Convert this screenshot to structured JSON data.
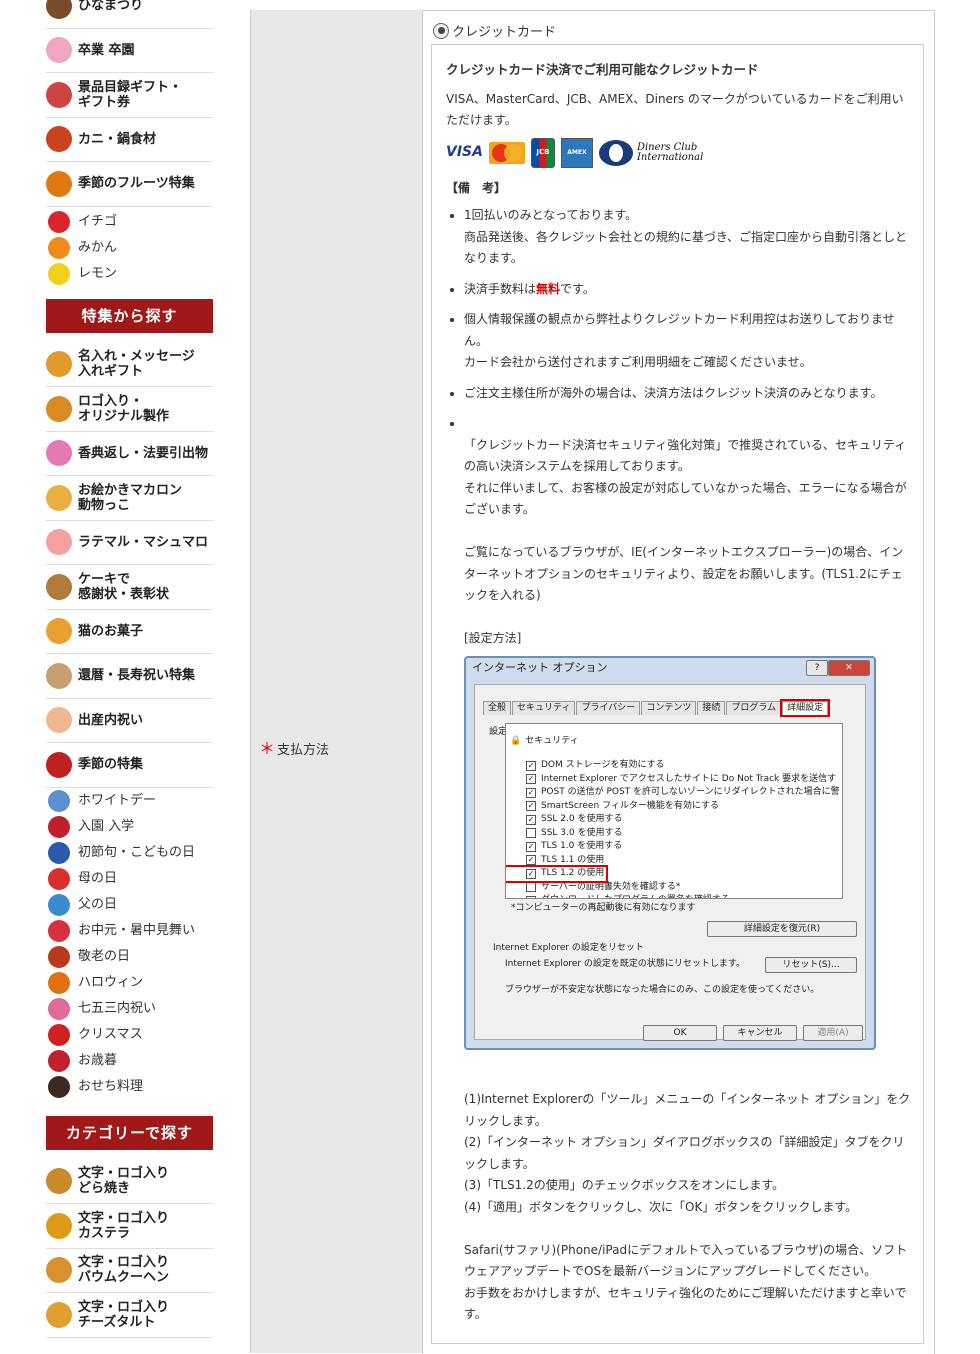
{
  "sidebar": {
    "top_items": [
      {
        "label": "ひなまつり",
        "color": "#7a4a2a",
        "icon": "hinamatsuri-icon"
      },
      {
        "label": "卒業 卒園",
        "color": "#f0a5c0",
        "icon": "sakura-icon"
      },
      {
        "label": "景品目録ギフト・\nギフト券",
        "color": "#c44",
        "icon": "gift-list-icon"
      },
      {
        "label": "カニ・鍋食材",
        "color": "#c8431e",
        "icon": "crab-icon"
      },
      {
        "label": "季節のフルーツ特集",
        "color": "#e07a10",
        "icon": "fruit-icon"
      }
    ],
    "fruit_items": [
      {
        "label": "イチゴ",
        "color": "#d8262b",
        "icon": "strawberry-icon"
      },
      {
        "label": "みかん",
        "color": "#f08a1a",
        "icon": "mandarin-icon"
      },
      {
        "label": "レモン",
        "color": "#f0d01a",
        "icon": "lemon-icon"
      }
    ],
    "feature_header": "特集から探す",
    "feature_items": [
      {
        "label": "名入れ・メッセージ\n入れギフト",
        "color": "#e09a2a",
        "icon": "name-gift-icon"
      },
      {
        "label": "ロゴ入り・\nオリジナル製作",
        "color": "#d98a22",
        "icon": "logo-original-icon"
      },
      {
        "label": "香典返し・法要引出物",
        "color": "#e57ab0",
        "icon": "lotus-icon"
      },
      {
        "label": "お絵かきマカロン\n動物っこ",
        "color": "#e8b040",
        "icon": "macaron-icon"
      },
      {
        "label": "ラテマル・マシュマロ",
        "color": "#f4a0a0",
        "icon": "marshmallow-icon"
      },
      {
        "label": "ケーキで\n感謝状・表彰状",
        "color": "#b07a3a",
        "icon": "cake-certificate-icon"
      },
      {
        "label": "猫のお菓子",
        "color": "#e8a030",
        "icon": "cat-sweets-icon"
      },
      {
        "label": "還暦・長寿祝い特集",
        "color": "#c8a070",
        "icon": "elder-icon"
      },
      {
        "label": "出産内祝い",
        "color": "#f0b890",
        "icon": "baby-icon"
      },
      {
        "label": "季節の特集",
        "color": "#c02020",
        "icon": "season-kanji-icon"
      }
    ],
    "season_items": [
      {
        "label": "ホワイトデー",
        "color": "#5a8fd0",
        "icon": "whiteday-icon"
      },
      {
        "label": "入園 入学",
        "color": "#c0202a",
        "icon": "school-bag-icon"
      },
      {
        "label": "初節句・こどもの日",
        "color": "#2a5ab0",
        "icon": "koinobori-icon"
      },
      {
        "label": "母の日",
        "color": "#d83030",
        "icon": "carnation-icon"
      },
      {
        "label": "父の日",
        "color": "#3a8ad0",
        "icon": "father-icon"
      },
      {
        "label": "お中元・暑中見舞い",
        "color": "#d83040",
        "icon": "noshi-icon"
      },
      {
        "label": "敬老の日",
        "color": "#b83a1a",
        "icon": "maple-icon"
      },
      {
        "label": "ハロウィン",
        "color": "#e07010",
        "icon": "pumpkin-icon"
      },
      {
        "label": "七五三内祝い",
        "color": "#e06a9a",
        "icon": "shichigosan-icon"
      },
      {
        "label": "クリスマス",
        "color": "#d02020",
        "icon": "santa-hat-icon"
      },
      {
        "label": "お歳暮",
        "color": "#c02030",
        "icon": "oseibo-icon"
      },
      {
        "label": "おせち料理",
        "color": "#3a2a20",
        "icon": "osechi-icon"
      }
    ],
    "category_header": "カテゴリーで探す",
    "category_items": [
      {
        "label": "文字・ロゴ入り\nどら焼き",
        "color": "#c98a2a",
        "icon": "dorayaki-icon"
      },
      {
        "label": "文字・ロゴ入り\nカステラ",
        "color": "#e09a1a",
        "icon": "castella-icon"
      },
      {
        "label": "文字・ロゴ入り\nバウムクーヘン",
        "color": "#d99030",
        "icon": "baumkuchen-icon"
      },
      {
        "label": "文字・ロゴ入り\nチーズタルト",
        "color": "#e0a030",
        "icon": "cheese-tart-icon"
      }
    ]
  },
  "form": {
    "required_mark": "＊",
    "payment_label": "支払方法",
    "radio_label": "クレジットカード",
    "radio_selected": true
  },
  "card_info": {
    "title": "クレジットカード決済でご利用可能なクレジットカード",
    "description": "VISA、MasterCard、JCB、AMEX、Diners のマークがついているカードをご利用いただけます。",
    "logos": {
      "visa": "VISA",
      "mastercard": "MasterCard",
      "jcb": "JCB",
      "amex": "AMEX",
      "diners_line1": "Diners Club",
      "diners_line2": "International"
    },
    "notes_heading": "【備　考】",
    "note1": "1回払いのみとなっております。\n商品発送後、各クレジット会社との規約に基づき、ご指定口座から自動引落としとなります。",
    "note2_before": "決済手数料は",
    "note2_free": "無料",
    "note2_after": "です。",
    "note3": "個人情報保護の観点から弊社よりクレジットカード利用控はお送りしておりません。\nカード会社から送付されますご利用明細をご確認くださいませ。",
    "note4": "ご注文主様住所が海外の場合は、決済方法はクレジット決済のみとなります。",
    "note5": "「クレジットカード決済セキュリティ強化対策」で推奨されている、セキュリティの高い決済システムを採用しております。\nそれに伴いまして、お客様の設定が対応していなかった場合、エラーになる場合がございます。\n\nご覧になっているブラウザが、IE(インターネットエクスプローラー)の場合、インターネットオプションのセキュリティより、設定をお願いします。(TLS1.2にチェックを入れる)\n\n[設定方法]",
    "steps": "(1)Internet Explorerの「ツール」メニューの「インターネット オプション」をクリックします。\n(2)「インターネット オプション」ダイアログボックスの「詳細設定」タブをクリックします。\n(3)「TLS1.2の使用」のチェックボックスをオンにします。\n(4)「適用」ボタンをクリックし、次に「OK」ボタンをクリックします。\n\nSafari(サファリ)(Phone/iPadにデフォルトで入っているブラウザ)の場合、ソフトウェアアップデートでOSを最新バージョンにアップグレードしてください。\nお手数をおかけしますが、セキュリティ強化のためにご理解いただけますと幸いです。"
  },
  "ie_dialog": {
    "title": "インターネット オプション",
    "help_button": "?",
    "close_button": "✕",
    "tabs": [
      "全般",
      "セキュリティ",
      "プライバシー",
      "コンテンツ",
      "接続",
      "プログラム",
      "詳細設定"
    ],
    "active_tab": "詳細設定",
    "settings_label": "設定",
    "section": "セキュリティ",
    "options": [
      {
        "label": "DOM ストレージを有効にする",
        "checked": true
      },
      {
        "label": "Internet Explorer でアクセスしたサイトに Do Not Track 要求を送信す",
        "checked": true
      },
      {
        "label": "POST の送信が POST を許可しないゾーンにリダイレクトされた場合に警",
        "checked": true
      },
      {
        "label": "SmartScreen フィルター機能を有効にする",
        "checked": true
      },
      {
        "label": "SSL 2.0 を使用する",
        "checked": true
      },
      {
        "label": "SSL 3.0 を使用する",
        "checked": false
      },
      {
        "label": "TLS 1.0 を使用する",
        "checked": true
      },
      {
        "label": "TLS 1.1 の使用",
        "checked": true
      },
      {
        "label": "TLS 1.2 の使用",
        "checked": true,
        "highlight": true
      },
      {
        "label": "サーバーの証明書失効を確認する*",
        "checked": false
      },
      {
        "label": "ダウンロードしたプログラムの署名を確認する",
        "checked": true
      }
    ],
    "restart_note": "*コンピューターの再起動後に有効になります",
    "restore_button": "詳細設定を復元(R)",
    "reset_section": "Internet Explorer の設定をリセット",
    "reset_desc": "Internet Explorer の設定を既定の状態にリセットします。",
    "reset_button": "リセット(S)...",
    "reset_note": "ブラウザーが不安定な状態になった場合にのみ、この設定を使ってください。",
    "ok_button": "OK",
    "cancel_button": "キャンセル",
    "apply_button": "適用(A)"
  }
}
